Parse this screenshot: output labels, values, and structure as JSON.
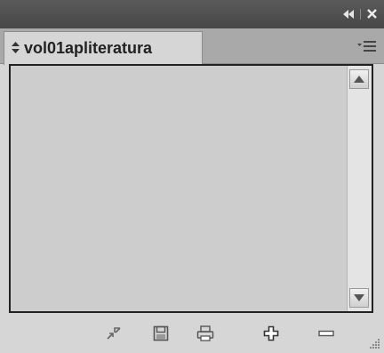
{
  "panel": {
    "tab_label": "vol01apliteratura",
    "icons": {
      "collapse": "double-left-arrow-icon",
      "close": "close-icon",
      "tab_sort": "up-down-arrows-icon",
      "panel_menu": "panel-menu-icon",
      "scroll_up": "scroll-up-arrow-icon",
      "scroll_down": "scroll-down-arrow-icon"
    },
    "toolbar_icons": [
      "relink-icon",
      "save-icon",
      "print-icon",
      "add-icon",
      "remove-icon"
    ]
  },
  "colors": {
    "titlebar": "#4f4f4f",
    "panel_bg": "#d6d6d6",
    "list_bg": "#cdcdcd",
    "list_border": "#222222"
  }
}
